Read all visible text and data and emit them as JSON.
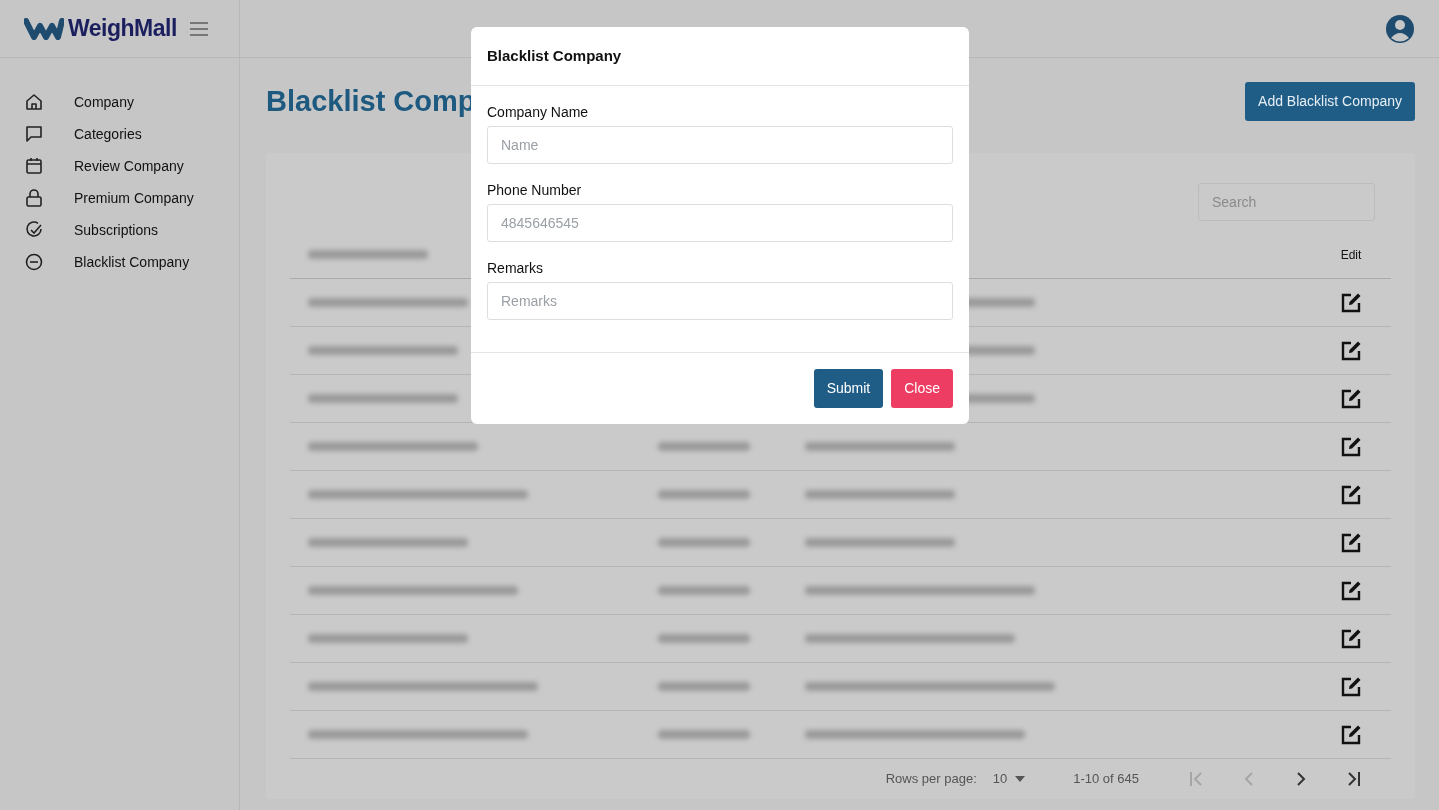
{
  "brand": {
    "name": "WeighMall"
  },
  "sidebar": {
    "items": [
      {
        "label": "Company"
      },
      {
        "label": "Categories"
      },
      {
        "label": "Review Company"
      },
      {
        "label": "Premium Company"
      },
      {
        "label": "Subscriptions"
      },
      {
        "label": "Blacklist Company"
      }
    ]
  },
  "page": {
    "title": "Blacklist Comp",
    "add_button": "Add Blacklist Company",
    "search": {
      "placeholder": "Search"
    }
  },
  "table": {
    "edit_header": "Edit",
    "rows": [
      {
        "kind": "blurred"
      },
      {
        "kind": "blurred"
      },
      {
        "kind": "blurred"
      },
      {
        "kind": "blurred"
      },
      {
        "kind": "blurred"
      },
      {
        "kind": "blurred"
      },
      {
        "kind": "blurred"
      },
      {
        "kind": "blurred"
      },
      {
        "kind": "blurred"
      },
      {
        "kind": "blurred"
      }
    ]
  },
  "pagination": {
    "rows_label": "Rows per page:",
    "rows_value": "10",
    "range": "1-10 of 645",
    "buttons": [
      {
        "kind": "first",
        "disabled": true
      },
      {
        "kind": "prev",
        "disabled": true
      },
      {
        "kind": "next",
        "disabled": false
      },
      {
        "kind": "last",
        "disabled": false
      }
    ]
  },
  "modal": {
    "title": "Blacklist Company",
    "fields": [
      {
        "label": "Company Name",
        "placeholder": "Name"
      },
      {
        "label": "Phone Number",
        "placeholder": "4845646545"
      },
      {
        "label": "Remarks",
        "placeholder": "Remarks"
      }
    ],
    "buttons": [
      {
        "label": "Submit",
        "kind": "primary"
      },
      {
        "label": "Close",
        "kind": "danger"
      }
    ]
  }
}
